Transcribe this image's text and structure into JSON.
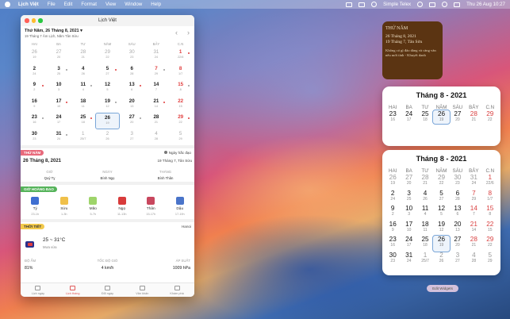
{
  "menubar": {
    "app": "Lịch Việt",
    "items": [
      "File",
      "Edit",
      "Format",
      "View",
      "Window",
      "Help"
    ],
    "right_app": "Simple Telex",
    "clock": "Thu 26 Aug  10:27"
  },
  "window": {
    "title": "Lịch Việt",
    "solar_date": "Thứ Năm, 26 Tháng 8, 2021",
    "lunar_date": "19 Tháng 7 Âm Lịch, Năm Tân Sửu",
    "weekdays": [
      "HAI",
      "BA",
      "TƯ",
      "NĂM",
      "SÁU",
      "BẢY",
      "C.N"
    ],
    "days": [
      {
        "s": "26",
        "l": "19",
        "o": true
      },
      {
        "s": "27",
        "l": "20",
        "o": true
      },
      {
        "s": "28",
        "l": "21",
        "o": true
      },
      {
        "s": "29",
        "l": "22",
        "o": true
      },
      {
        "s": "30",
        "l": "23",
        "o": true
      },
      {
        "s": "31",
        "l": "24",
        "o": true
      },
      {
        "s": "1",
        "l": "22/6",
        "r": true
      },
      {
        "s": "2",
        "l": "24"
      },
      {
        "s": "3",
        "l": "25"
      },
      {
        "s": "4",
        "l": "26"
      },
      {
        "s": "5",
        "l": "27"
      },
      {
        "s": "6",
        "l": "28"
      },
      {
        "s": "7",
        "l": "29",
        "r": true
      },
      {
        "s": "8",
        "l": "1/7",
        "r": true
      },
      {
        "s": "9",
        "l": "2"
      },
      {
        "s": "10",
        "l": "3"
      },
      {
        "s": "11",
        "l": "4"
      },
      {
        "s": "12",
        "l": "5"
      },
      {
        "s": "13",
        "l": "6"
      },
      {
        "s": "14",
        "l": "7"
      },
      {
        "s": "15",
        "l": "8",
        "r": true
      },
      {
        "s": "16",
        "l": "9"
      },
      {
        "s": "17",
        "l": "10"
      },
      {
        "s": "18",
        "l": "11"
      },
      {
        "s": "19",
        "l": "12"
      },
      {
        "s": "20",
        "l": "13"
      },
      {
        "s": "21",
        "l": "14"
      },
      {
        "s": "22",
        "l": "15",
        "r": true
      },
      {
        "s": "23",
        "l": "16"
      },
      {
        "s": "24",
        "l": "17"
      },
      {
        "s": "25",
        "l": "18"
      },
      {
        "s": "26",
        "l": "19",
        "sel": true
      },
      {
        "s": "27",
        "l": "20"
      },
      {
        "s": "28",
        "l": "21"
      },
      {
        "s": "29",
        "l": "22",
        "r": true
      },
      {
        "s": "30",
        "l": "23"
      },
      {
        "s": "31",
        "l": "24"
      },
      {
        "s": "1",
        "l": "25/7",
        "o": true
      },
      {
        "s": "2",
        "l": "26",
        "o": true
      },
      {
        "s": "3",
        "l": "27",
        "o": true
      },
      {
        "s": "4",
        "l": "28",
        "o": true
      },
      {
        "s": "5",
        "l": "29",
        "o": true
      }
    ],
    "day_section": {
      "tag": "THỨ NĂM",
      "good_day": "Ngày hắc đạo",
      "solar": "26 Tháng 8, 2021",
      "lunar": "19 Tháng 7, Tân Sửu",
      "cols": [
        {
          "k": "GIỜ",
          "v": "Quý Tỵ"
        },
        {
          "k": "NGÀY",
          "v": "Bính Ngọ"
        },
        {
          "k": "THÁNG",
          "v": "Bính Thân"
        }
      ]
    },
    "hours_section": {
      "tag": "GIỜ HOÀNG ĐẠO",
      "items": [
        {
          "n": "Tý",
          "t": "23-1h",
          "c": "#3f6fd1"
        },
        {
          "n": "Sửu",
          "t": "1-3h",
          "c": "#f0c04a"
        },
        {
          "n": "Mão",
          "t": "5-7h",
          "c": "#9ed46a"
        },
        {
          "n": "Ngọ",
          "t": "11-13h",
          "c": "#d83b3b"
        },
        {
          "n": "Thân",
          "t": "15-17h",
          "c": "#c8475e"
        },
        {
          "n": "Dậu",
          "t": "17-19h",
          "c": "#4a74c9"
        }
      ]
    },
    "weather_section": {
      "tag": "THỜI TIẾT",
      "city": "Hanoi",
      "temp": "25 ~ 31°C",
      "cond": "Mưa vừa",
      "stats": [
        {
          "k": "ĐỘ ẨM",
          "v": "81%"
        },
        {
          "k": "TỐC ĐỘ GIÓ",
          "v": "4 km/h"
        },
        {
          "k": "ÁP SUẤT",
          "v": "1009 hPa"
        }
      ]
    },
    "tabs": [
      "Lịch ngày",
      "Lịch tháng",
      "Đổi ngày",
      "Văn khấn",
      "Khám phá"
    ]
  },
  "note_widget": {
    "title": "THỨ NĂM",
    "line1": "26 Tháng 8, 2021",
    "line2": "19 Tháng 7, Tân Sửu",
    "body": "Không có gì đáo dàng và càng văn nếu mới tính - Khuyết danh"
  },
  "month_widget_small": {
    "title": "Tháng 8 - 2021",
    "weekdays": [
      "HAI",
      "BA",
      "TƯ",
      "NĂM",
      "SÁU",
      "BẢY",
      "C.N"
    ],
    "days": [
      {
        "s": "23",
        "l": "16"
      },
      {
        "s": "24",
        "l": "17"
      },
      {
        "s": "25",
        "l": "18"
      },
      {
        "s": "26",
        "l": "19",
        "sel": true
      },
      {
        "s": "27",
        "l": "20"
      },
      {
        "s": "28",
        "l": "21",
        "r": true
      },
      {
        "s": "29",
        "l": "22",
        "r": true
      }
    ]
  },
  "month_widget_large": {
    "title": "Tháng 8 - 2021",
    "weekdays": [
      "HAI",
      "BA",
      "TƯ",
      "NĂM",
      "SÁU",
      "BẢY",
      "C.N"
    ],
    "days": [
      {
        "s": "26",
        "l": "19",
        "o": true
      },
      {
        "s": "27",
        "l": "20",
        "o": true
      },
      {
        "s": "28",
        "l": "21",
        "o": true
      },
      {
        "s": "29",
        "l": "22",
        "o": true
      },
      {
        "s": "30",
        "l": "23",
        "o": true
      },
      {
        "s": "31",
        "l": "24",
        "o": true
      },
      {
        "s": "1",
        "l": "22/6",
        "r": true
      },
      {
        "s": "2",
        "l": "24"
      },
      {
        "s": "3",
        "l": "25"
      },
      {
        "s": "4",
        "l": "26"
      },
      {
        "s": "5",
        "l": "27"
      },
      {
        "s": "6",
        "l": "28"
      },
      {
        "s": "7",
        "l": "29",
        "r": true
      },
      {
        "s": "8",
        "l": "1/7",
        "r": true
      },
      {
        "s": "9",
        "l": "2"
      },
      {
        "s": "10",
        "l": "3"
      },
      {
        "s": "11",
        "l": "4"
      },
      {
        "s": "12",
        "l": "5"
      },
      {
        "s": "13",
        "l": "6"
      },
      {
        "s": "14",
        "l": "7",
        "r": true
      },
      {
        "s": "15",
        "l": "8",
        "r": true
      },
      {
        "s": "16",
        "l": "9"
      },
      {
        "s": "17",
        "l": "10"
      },
      {
        "s": "18",
        "l": "11"
      },
      {
        "s": "19",
        "l": "12"
      },
      {
        "s": "20",
        "l": "13"
      },
      {
        "s": "21",
        "l": "14",
        "r": true
      },
      {
        "s": "22",
        "l": "15",
        "r": true
      },
      {
        "s": "23",
        "l": "16"
      },
      {
        "s": "24",
        "l": "17"
      },
      {
        "s": "25",
        "l": "18"
      },
      {
        "s": "26",
        "l": "19",
        "sel": true
      },
      {
        "s": "27",
        "l": "20"
      },
      {
        "s": "28",
        "l": "21",
        "r": true
      },
      {
        "s": "29",
        "l": "22",
        "r": true
      },
      {
        "s": "30",
        "l": "23"
      },
      {
        "s": "31",
        "l": "24"
      },
      {
        "s": "1",
        "l": "25/7",
        "o": true
      },
      {
        "s": "2",
        "l": "26",
        "o": true
      },
      {
        "s": "3",
        "l": "27",
        "o": true
      },
      {
        "s": "4",
        "l": "28",
        "o": true
      },
      {
        "s": "5",
        "l": "29",
        "o": true
      }
    ]
  },
  "edit_widgets": "Edit Widgets"
}
